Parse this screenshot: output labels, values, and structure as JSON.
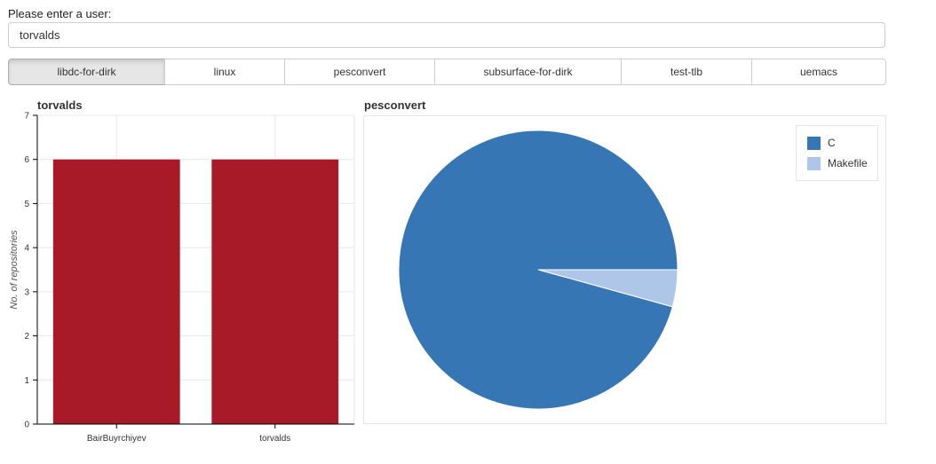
{
  "form": {
    "label": "Please enter a user:",
    "value": "torvalds"
  },
  "tabs": [
    {
      "label": "libdc-for-dirk",
      "active": true
    },
    {
      "label": "linux",
      "active": false
    },
    {
      "label": "pesconvert",
      "active": false
    },
    {
      "label": "subsurface-for-dirk",
      "active": false
    },
    {
      "label": "test-tlb",
      "active": false
    },
    {
      "label": "uemacs",
      "active": false
    }
  ],
  "colors": {
    "bar": "#a91a28",
    "pie_c": "#3676b4",
    "pie_makefile": "#aec7e8"
  },
  "chart_data": [
    {
      "type": "bar",
      "title": "torvalds",
      "categories": [
        "BairBuyrchiyev",
        "torvalds"
      ],
      "values": [
        6,
        6
      ],
      "xlabel": "",
      "ylabel": "No. of repositories",
      "ylim": [
        0,
        7
      ],
      "yticks": [
        "0",
        "1",
        "2",
        "3",
        "4",
        "5",
        "6",
        "7"
      ],
      "grid": true
    },
    {
      "type": "pie",
      "title": "pesconvert",
      "labels": [
        "C",
        "Makefile"
      ],
      "values": [
        95.7,
        4.3
      ],
      "legend_position": "top-right"
    }
  ]
}
